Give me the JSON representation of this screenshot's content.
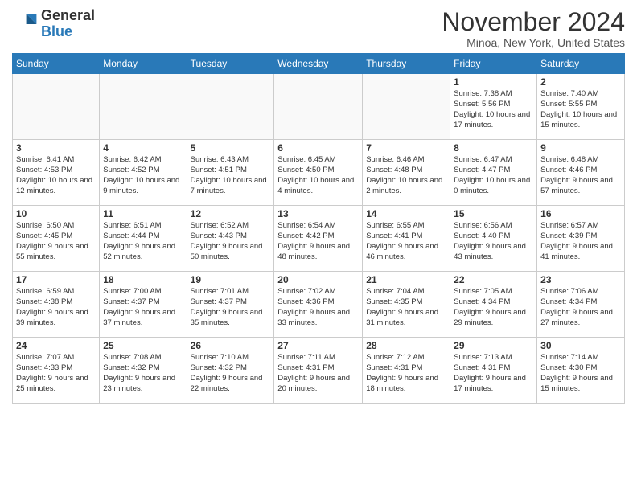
{
  "logo": {
    "line1": "General",
    "line2": "Blue"
  },
  "title": "November 2024",
  "location": "Minoa, New York, United States",
  "days_header": [
    "Sunday",
    "Monday",
    "Tuesday",
    "Wednesday",
    "Thursday",
    "Friday",
    "Saturday"
  ],
  "weeks": [
    [
      {
        "day": "",
        "info": ""
      },
      {
        "day": "",
        "info": ""
      },
      {
        "day": "",
        "info": ""
      },
      {
        "day": "",
        "info": ""
      },
      {
        "day": "",
        "info": ""
      },
      {
        "day": "1",
        "info": "Sunrise: 7:38 AM\nSunset: 5:56 PM\nDaylight: 10 hours and 17 minutes."
      },
      {
        "day": "2",
        "info": "Sunrise: 7:40 AM\nSunset: 5:55 PM\nDaylight: 10 hours and 15 minutes."
      }
    ],
    [
      {
        "day": "3",
        "info": "Sunrise: 6:41 AM\nSunset: 4:53 PM\nDaylight: 10 hours and 12 minutes."
      },
      {
        "day": "4",
        "info": "Sunrise: 6:42 AM\nSunset: 4:52 PM\nDaylight: 10 hours and 9 minutes."
      },
      {
        "day": "5",
        "info": "Sunrise: 6:43 AM\nSunset: 4:51 PM\nDaylight: 10 hours and 7 minutes."
      },
      {
        "day": "6",
        "info": "Sunrise: 6:45 AM\nSunset: 4:50 PM\nDaylight: 10 hours and 4 minutes."
      },
      {
        "day": "7",
        "info": "Sunrise: 6:46 AM\nSunset: 4:48 PM\nDaylight: 10 hours and 2 minutes."
      },
      {
        "day": "8",
        "info": "Sunrise: 6:47 AM\nSunset: 4:47 PM\nDaylight: 10 hours and 0 minutes."
      },
      {
        "day": "9",
        "info": "Sunrise: 6:48 AM\nSunset: 4:46 PM\nDaylight: 9 hours and 57 minutes."
      }
    ],
    [
      {
        "day": "10",
        "info": "Sunrise: 6:50 AM\nSunset: 4:45 PM\nDaylight: 9 hours and 55 minutes."
      },
      {
        "day": "11",
        "info": "Sunrise: 6:51 AM\nSunset: 4:44 PM\nDaylight: 9 hours and 52 minutes."
      },
      {
        "day": "12",
        "info": "Sunrise: 6:52 AM\nSunset: 4:43 PM\nDaylight: 9 hours and 50 minutes."
      },
      {
        "day": "13",
        "info": "Sunrise: 6:54 AM\nSunset: 4:42 PM\nDaylight: 9 hours and 48 minutes."
      },
      {
        "day": "14",
        "info": "Sunrise: 6:55 AM\nSunset: 4:41 PM\nDaylight: 9 hours and 46 minutes."
      },
      {
        "day": "15",
        "info": "Sunrise: 6:56 AM\nSunset: 4:40 PM\nDaylight: 9 hours and 43 minutes."
      },
      {
        "day": "16",
        "info": "Sunrise: 6:57 AM\nSunset: 4:39 PM\nDaylight: 9 hours and 41 minutes."
      }
    ],
    [
      {
        "day": "17",
        "info": "Sunrise: 6:59 AM\nSunset: 4:38 PM\nDaylight: 9 hours and 39 minutes."
      },
      {
        "day": "18",
        "info": "Sunrise: 7:00 AM\nSunset: 4:37 PM\nDaylight: 9 hours and 37 minutes."
      },
      {
        "day": "19",
        "info": "Sunrise: 7:01 AM\nSunset: 4:37 PM\nDaylight: 9 hours and 35 minutes."
      },
      {
        "day": "20",
        "info": "Sunrise: 7:02 AM\nSunset: 4:36 PM\nDaylight: 9 hours and 33 minutes."
      },
      {
        "day": "21",
        "info": "Sunrise: 7:04 AM\nSunset: 4:35 PM\nDaylight: 9 hours and 31 minutes."
      },
      {
        "day": "22",
        "info": "Sunrise: 7:05 AM\nSunset: 4:34 PM\nDaylight: 9 hours and 29 minutes."
      },
      {
        "day": "23",
        "info": "Sunrise: 7:06 AM\nSunset: 4:34 PM\nDaylight: 9 hours and 27 minutes."
      }
    ],
    [
      {
        "day": "24",
        "info": "Sunrise: 7:07 AM\nSunset: 4:33 PM\nDaylight: 9 hours and 25 minutes."
      },
      {
        "day": "25",
        "info": "Sunrise: 7:08 AM\nSunset: 4:32 PM\nDaylight: 9 hours and 23 minutes."
      },
      {
        "day": "26",
        "info": "Sunrise: 7:10 AM\nSunset: 4:32 PM\nDaylight: 9 hours and 22 minutes."
      },
      {
        "day": "27",
        "info": "Sunrise: 7:11 AM\nSunset: 4:31 PM\nDaylight: 9 hours and 20 minutes."
      },
      {
        "day": "28",
        "info": "Sunrise: 7:12 AM\nSunset: 4:31 PM\nDaylight: 9 hours and 18 minutes."
      },
      {
        "day": "29",
        "info": "Sunrise: 7:13 AM\nSunset: 4:31 PM\nDaylight: 9 hours and 17 minutes."
      },
      {
        "day": "30",
        "info": "Sunrise: 7:14 AM\nSunset: 4:30 PM\nDaylight: 9 hours and 15 minutes."
      }
    ]
  ]
}
